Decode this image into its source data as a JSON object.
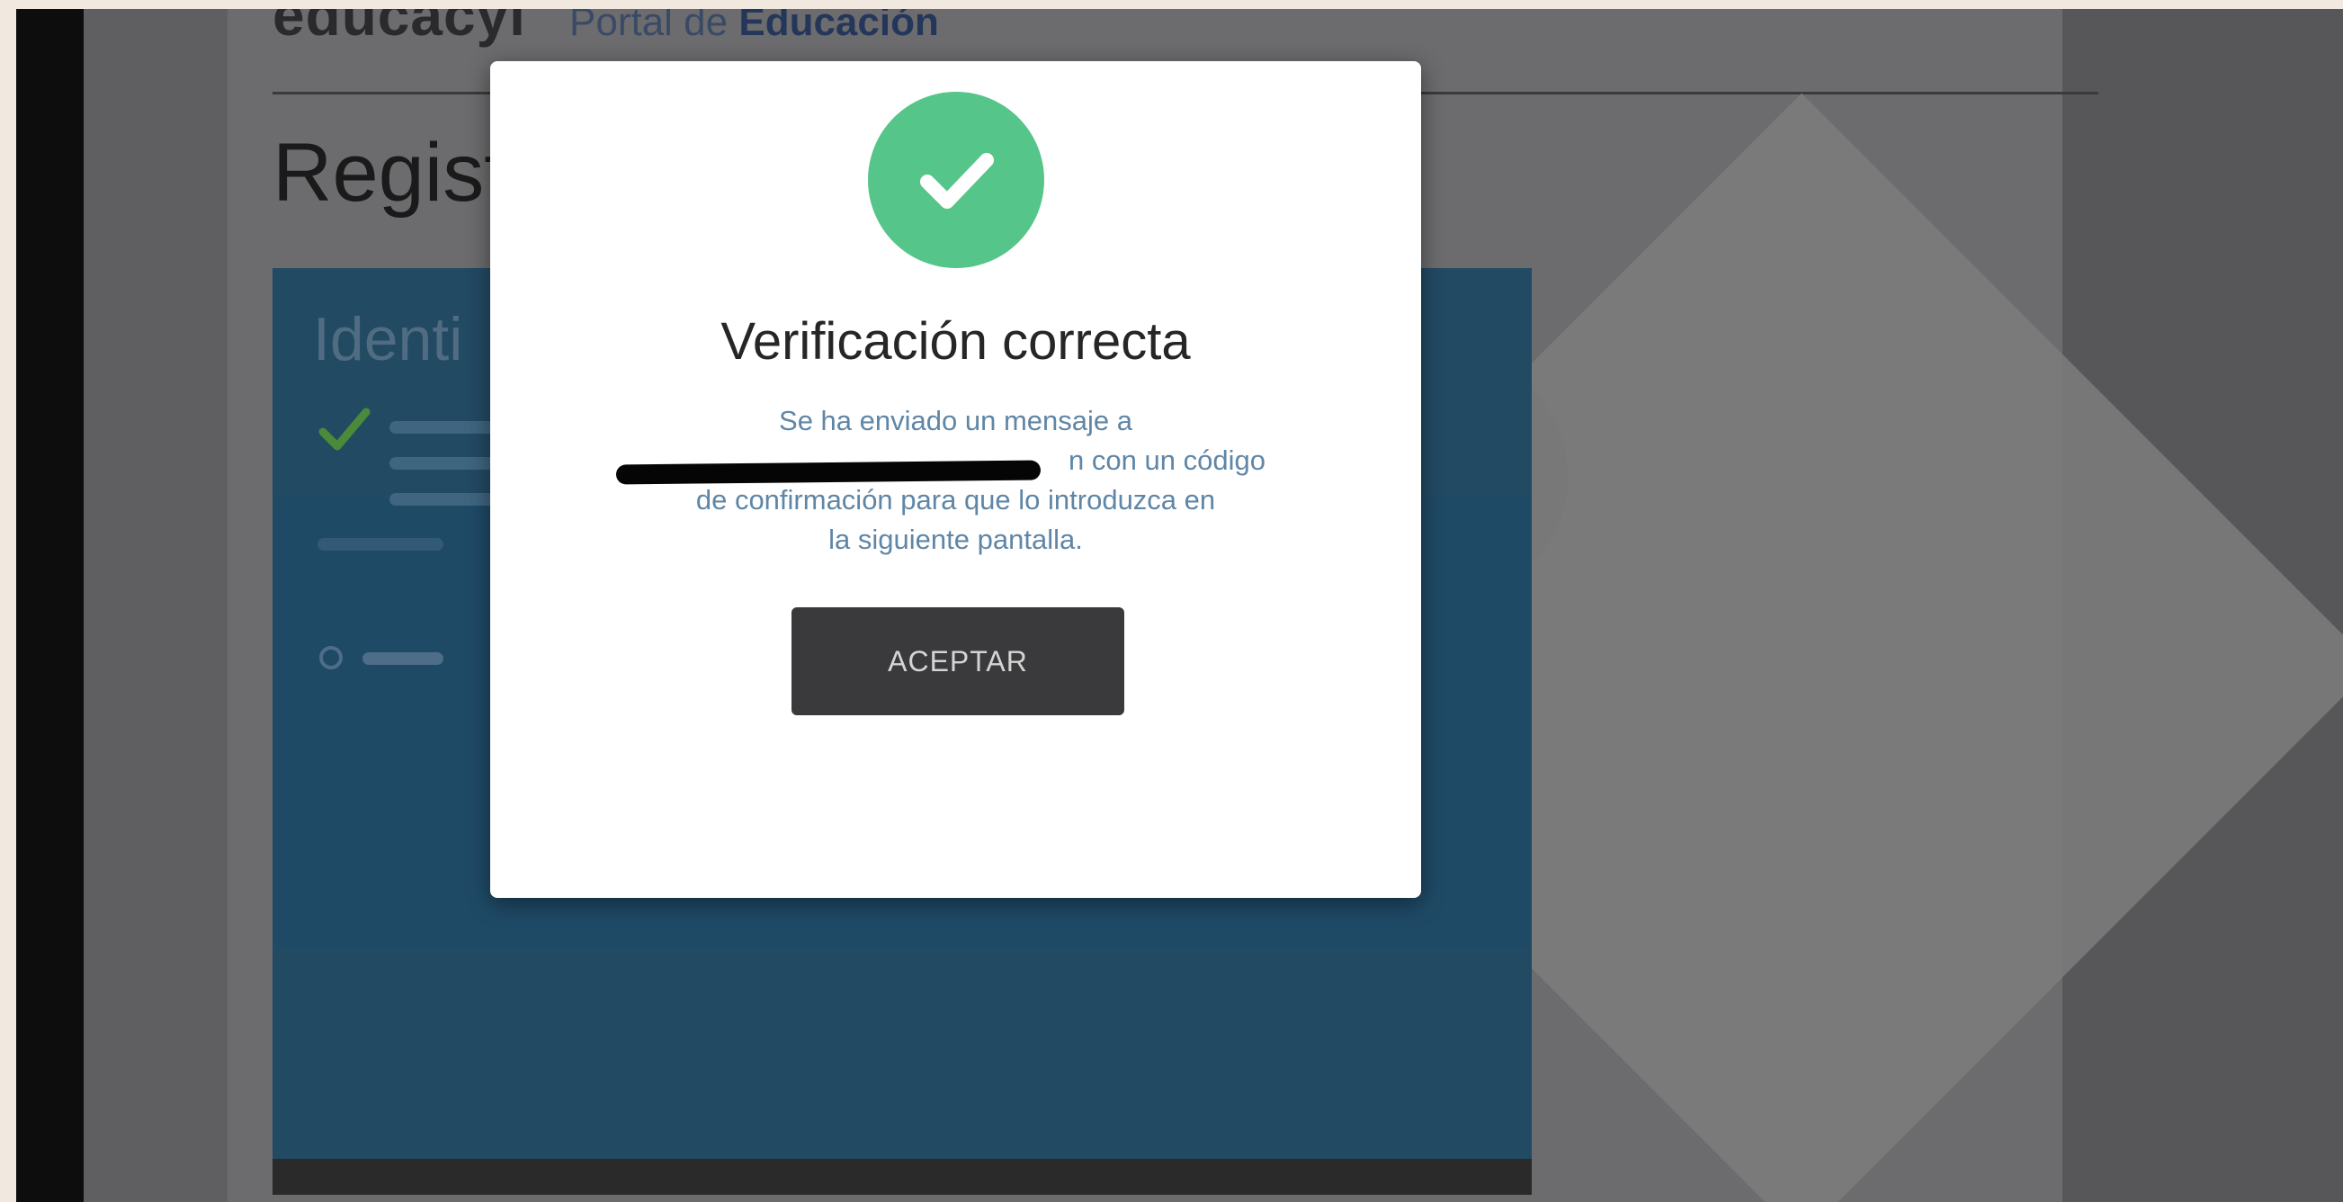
{
  "background_page": {
    "logo": "educacyl",
    "logo_subtitle_prefix": "Portal de",
    "logo_subtitle_emphasis": "Educación",
    "heading_visible": "Regist",
    "card_title_visible": "Identi"
  },
  "modal": {
    "icon": "check-circle-icon",
    "icon_color": "#56c58a",
    "title": "Verificación correcta",
    "message_line_1": "Se ha enviado un mensaje a",
    "message_line_2_suffix": "n con un código",
    "message_line_3": "de confirmación para que lo introduzca en",
    "message_line_4": "la siguiente pantalla.",
    "accept_label": "ACEPTAR"
  },
  "colors": {
    "message_text": "#5f86a6",
    "button_background": "#3a3a3c",
    "card_blue": "#234a63"
  }
}
